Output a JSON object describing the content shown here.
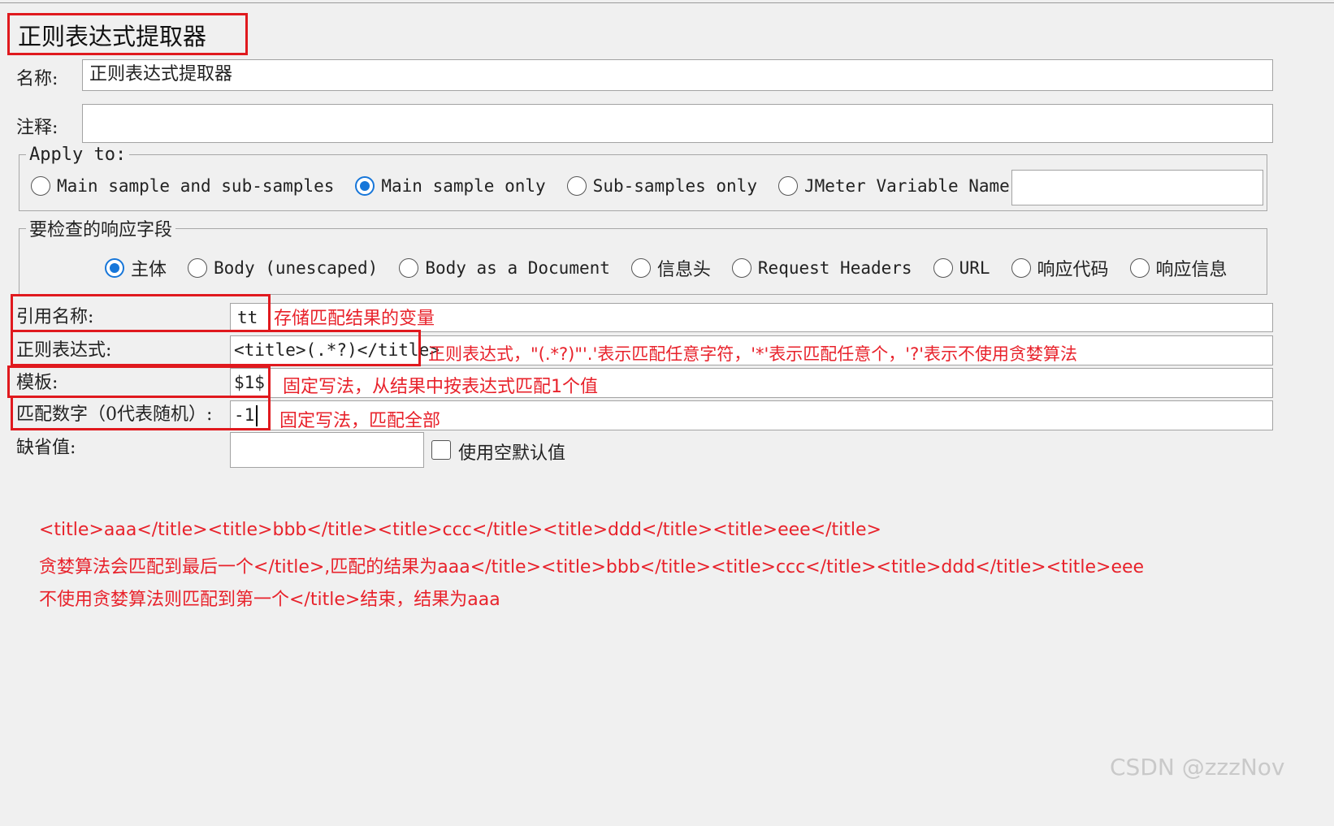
{
  "panel": {
    "title": "正则表达式提取器",
    "name_label": "名称:",
    "name_value": "正则表达式提取器",
    "comment_label": "注释:",
    "comment_value": ""
  },
  "apply_to": {
    "legend": "Apply to:",
    "options": [
      "Main sample and sub-samples",
      "Main sample only",
      "Sub-samples only",
      "JMeter Variable Name to use"
    ],
    "selected": "Main sample only",
    "variable_value": ""
  },
  "response_field": {
    "legend": "要检查的响应字段",
    "options": [
      "主体",
      "Body (unescaped)",
      "Body as a Document",
      "信息头",
      "Request Headers",
      "URL",
      "响应代码",
      "响应信息"
    ],
    "selected": "主体"
  },
  "fields": {
    "ref_name_label": "引用名称:",
    "ref_name_value": "tt",
    "regex_label": "正则表达式:",
    "regex_value": "<title>(.*?)</title>",
    "template_label": "模板:",
    "template_value": "$1$",
    "match_no_label": "匹配数字（0代表随机）:",
    "match_no_value": "-1",
    "default_label": "缺省值:",
    "default_value": "",
    "use_empty_default_label": "使用空默认值",
    "use_empty_default_checked": false
  },
  "annotations": {
    "ref_name_note": "存储匹配结果的变量",
    "regex_note": "正则表达式，\"(.*?)\"'.'表示匹配任意字符，'*'表示匹配任意个，'?'表示不使用贪婪算法",
    "template_note": "固定写法，从结果中按表达式匹配1个值",
    "match_no_note": "固定写法，匹配全部",
    "example_line1": "<title>aaa</title><title>bbb</title><title>ccc</title><title>ddd</title><title>eee</title>",
    "example_line2": "贪婪算法会匹配到最后一个</title>,匹配的结果为aaa</title><title>bbb</title><title>ccc</title><title>ddd</title><title>eee",
    "example_line3": "不使用贪婪算法则匹配到第一个</title>结束，结果为aaa"
  },
  "watermark": "CSDN @zzzNov",
  "colors": {
    "annotation_red": "#e8222b",
    "radio_blue": "#1676d9",
    "background": "#f0f0f0"
  }
}
